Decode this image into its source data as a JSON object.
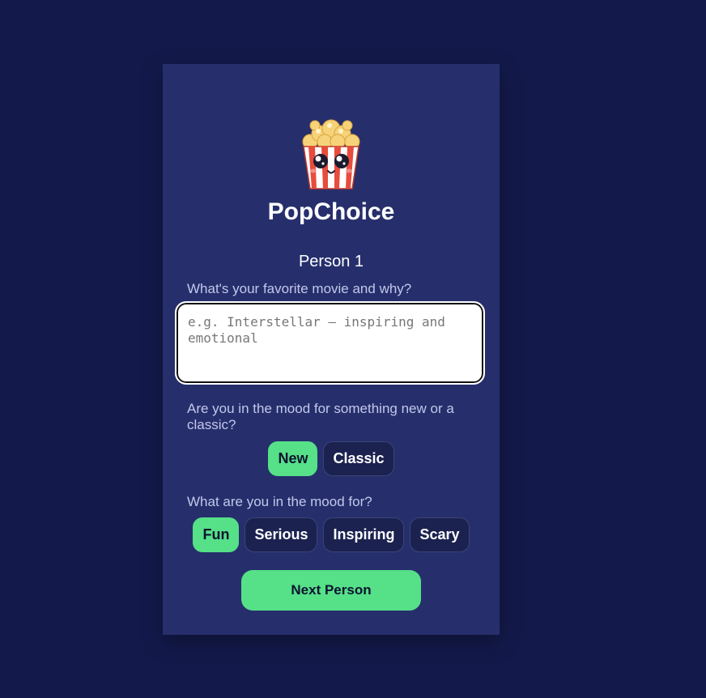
{
  "app": {
    "title": "PopChoice",
    "logo_icon": "popcorn-mascot-icon"
  },
  "person": {
    "label": "Person 1"
  },
  "questions": {
    "favorite_movie": {
      "label": "What's your favorite movie and why?",
      "placeholder": "e.g. Interstellar – inspiring and emotional",
      "value": ""
    },
    "era": {
      "label": "Are you in the mood for something new or a classic?",
      "options": [
        {
          "label": "New",
          "selected": true
        },
        {
          "label": "Classic",
          "selected": false
        }
      ]
    },
    "mood": {
      "label": "What are you in the mood for?",
      "options": [
        {
          "label": "Fun",
          "selected": true
        },
        {
          "label": "Serious",
          "selected": false
        },
        {
          "label": "Inspiring",
          "selected": false
        },
        {
          "label": "Scary",
          "selected": false
        }
      ]
    }
  },
  "actions": {
    "next_label": "Next Person"
  },
  "colors": {
    "page_background": "#131a4b",
    "card_background": "#262f6c",
    "accent": "#56e088",
    "chip_background": "#1b2250"
  }
}
